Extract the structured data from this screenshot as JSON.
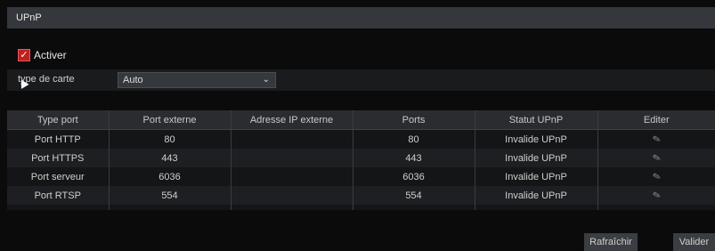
{
  "window": {
    "title": "UPnP"
  },
  "enable": {
    "label": "Activer",
    "checked": true
  },
  "map_type": {
    "label": "type de carte",
    "value": "Auto"
  },
  "table": {
    "headers": [
      "Type port",
      "Port externe",
      "Adresse IP externe",
      "Ports",
      "Statut UPnP",
      "Editer"
    ],
    "rows": [
      {
        "type": "Port HTTP",
        "external": "80",
        "ip": "",
        "port": "80",
        "status": "Invalide UPnP"
      },
      {
        "type": "Port HTTPS",
        "external": "443",
        "ip": "",
        "port": "443",
        "status": "Invalide UPnP"
      },
      {
        "type": "Port serveur",
        "external": "6036",
        "ip": "",
        "port": "6036",
        "status": "Invalide UPnP"
      },
      {
        "type": "Port RTSP",
        "external": "554",
        "ip": "",
        "port": "554",
        "status": "Invalide UPnP"
      }
    ]
  },
  "buttons": {
    "refresh": "Rafraîchir",
    "ok": "Valider"
  },
  "icons": {
    "edit": "pencil-icon",
    "check": "checkmark-icon",
    "dropdown": "chevron-down-icon"
  }
}
